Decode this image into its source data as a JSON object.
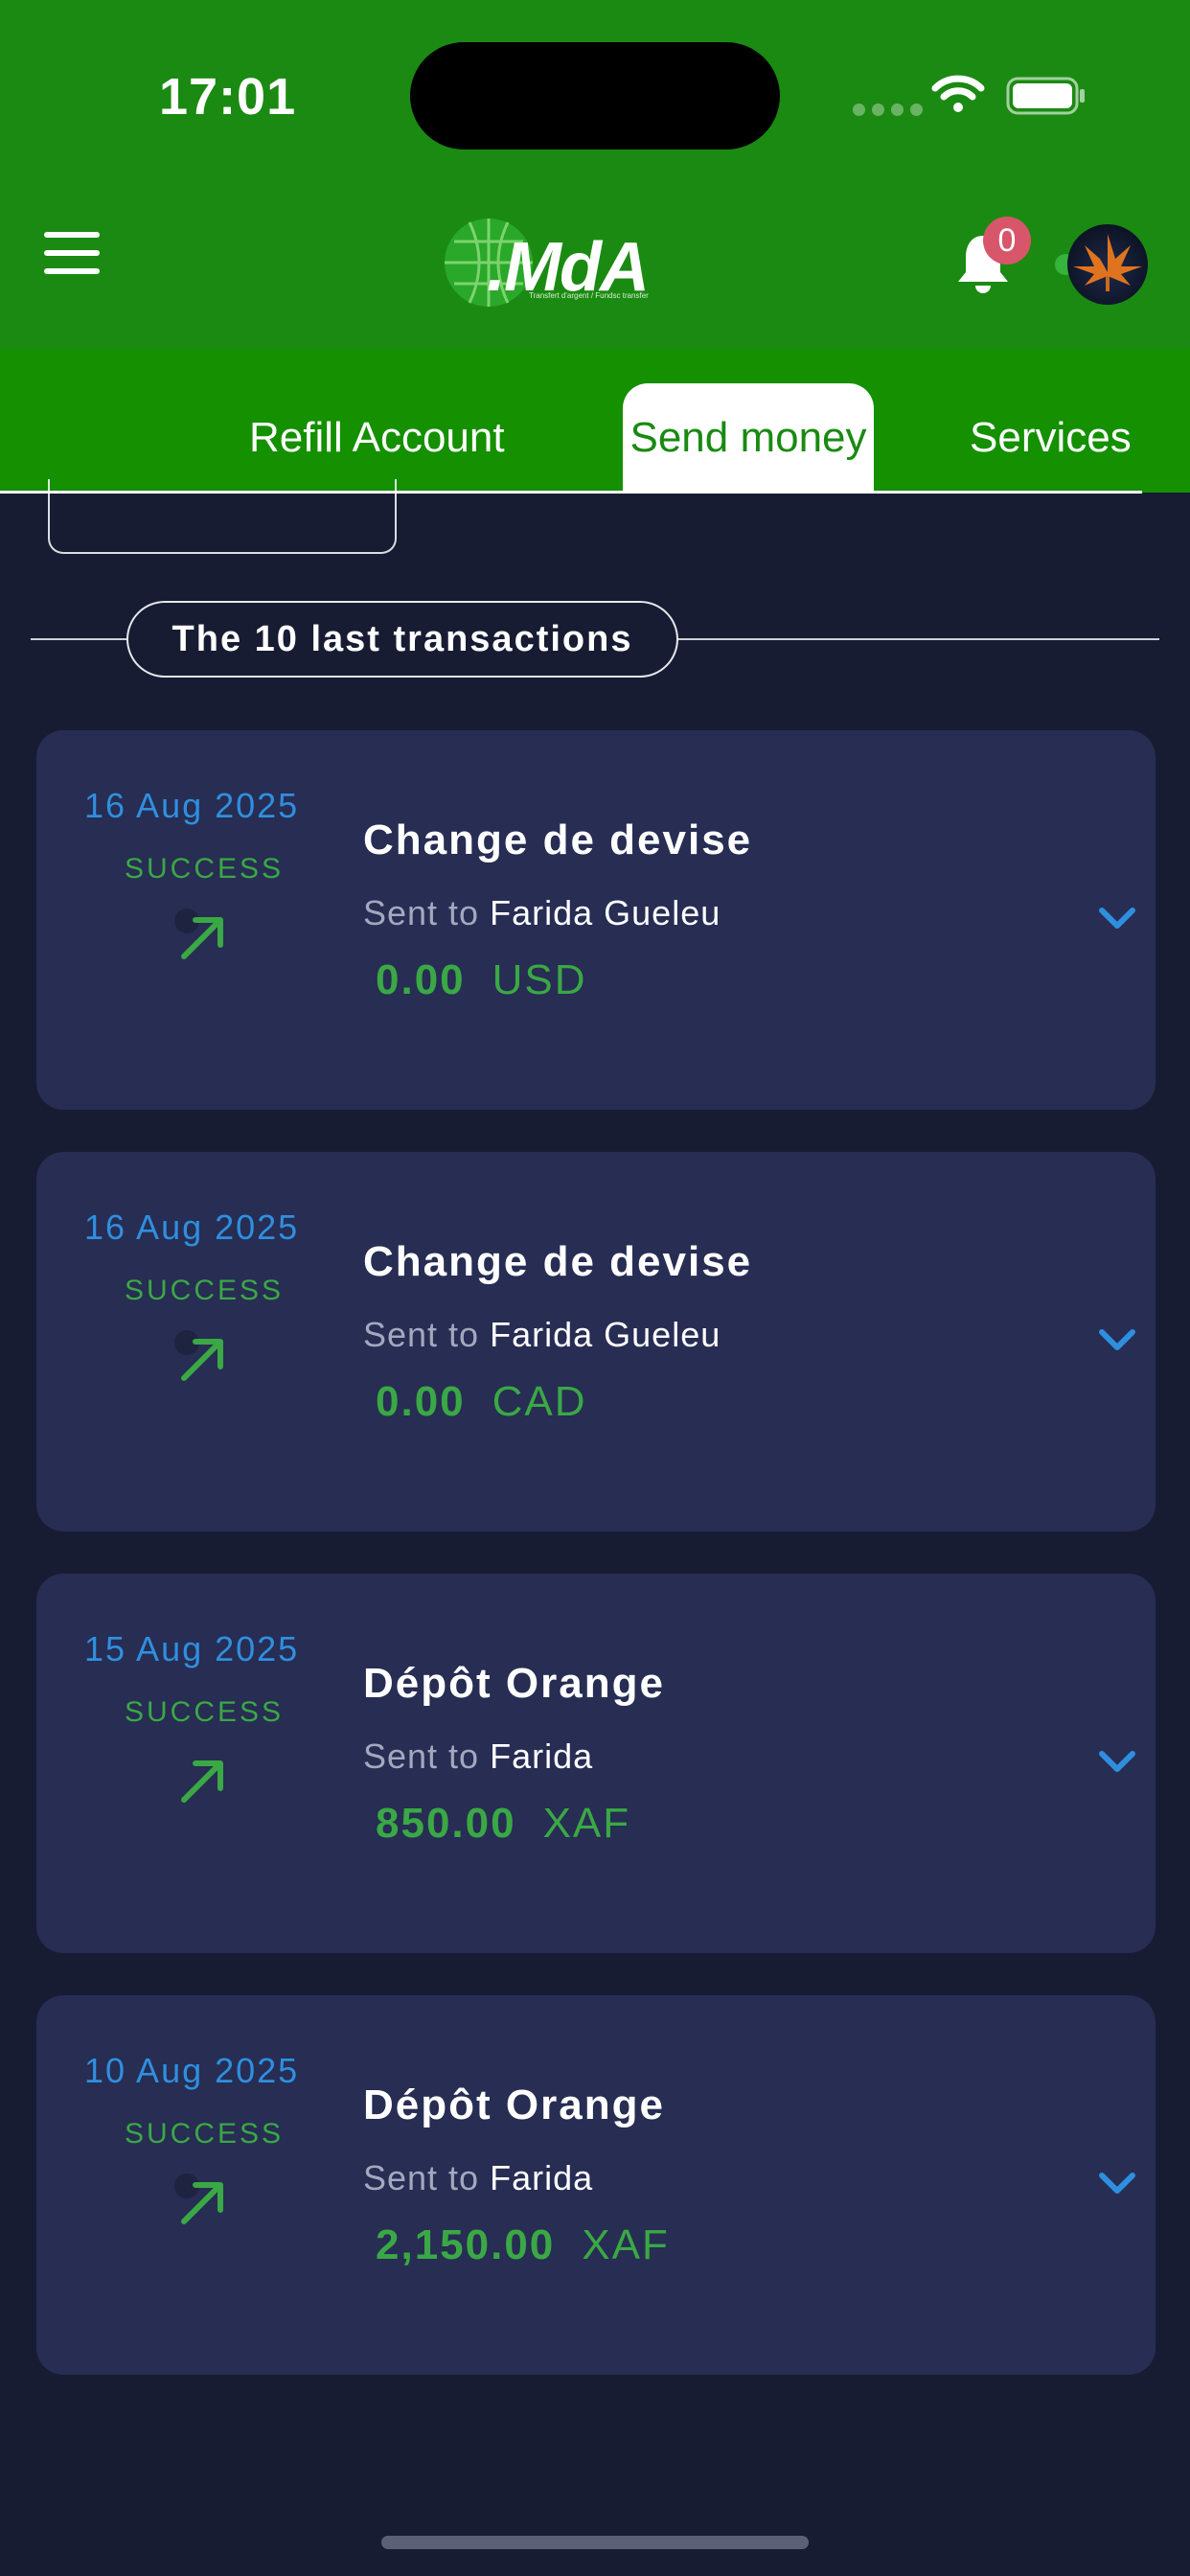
{
  "status_bar": {
    "time": "17:01"
  },
  "header": {
    "logo_text": ".MdA",
    "logo_subtitle": "Transfert d'argent / Fundsc transfer",
    "notification_count": "0"
  },
  "tabs": [
    {
      "label": "Refill Account",
      "active": false
    },
    {
      "label": "Send money",
      "active": true
    },
    {
      "label": "Services",
      "active": false
    }
  ],
  "section_title": "The 10 last transactions",
  "transactions": [
    {
      "date": "16 Aug 2025",
      "status": "SUCCESS",
      "title": "Change de devise",
      "sent_label": "Sent to",
      "recipient": "Farida Gueleu",
      "amount": "0.00",
      "currency": "USD"
    },
    {
      "date": "16 Aug 2025",
      "status": "SUCCESS",
      "title": "Change de devise",
      "sent_label": "Sent to",
      "recipient": "Farida Gueleu",
      "amount": "0.00",
      "currency": "CAD"
    },
    {
      "date": "15 Aug 2025",
      "status": "SUCCESS",
      "title": "Dépôt Orange",
      "sent_label": "Sent to",
      "recipient": "Farida",
      "amount": "850.00",
      "currency": "XAF"
    },
    {
      "date": "10 Aug 2025",
      "status": "SUCCESS",
      "title": "Dépôt Orange",
      "sent_label": "Sent to",
      "recipient": "Farida",
      "amount": "2,150.00",
      "currency": "XAF"
    }
  ],
  "colors": {
    "header_green": "#1b8a12",
    "tab_green": "#149000",
    "background": "#181c33",
    "card": "#272d53",
    "date_blue": "#2f8fdf",
    "success_green": "#3aa845",
    "badge_red": "#d7566a"
  },
  "icons": [
    "menu-icon",
    "bell-icon",
    "wifi-icon",
    "battery-icon",
    "arrow-up-right-icon",
    "chevron-down-icon"
  ]
}
